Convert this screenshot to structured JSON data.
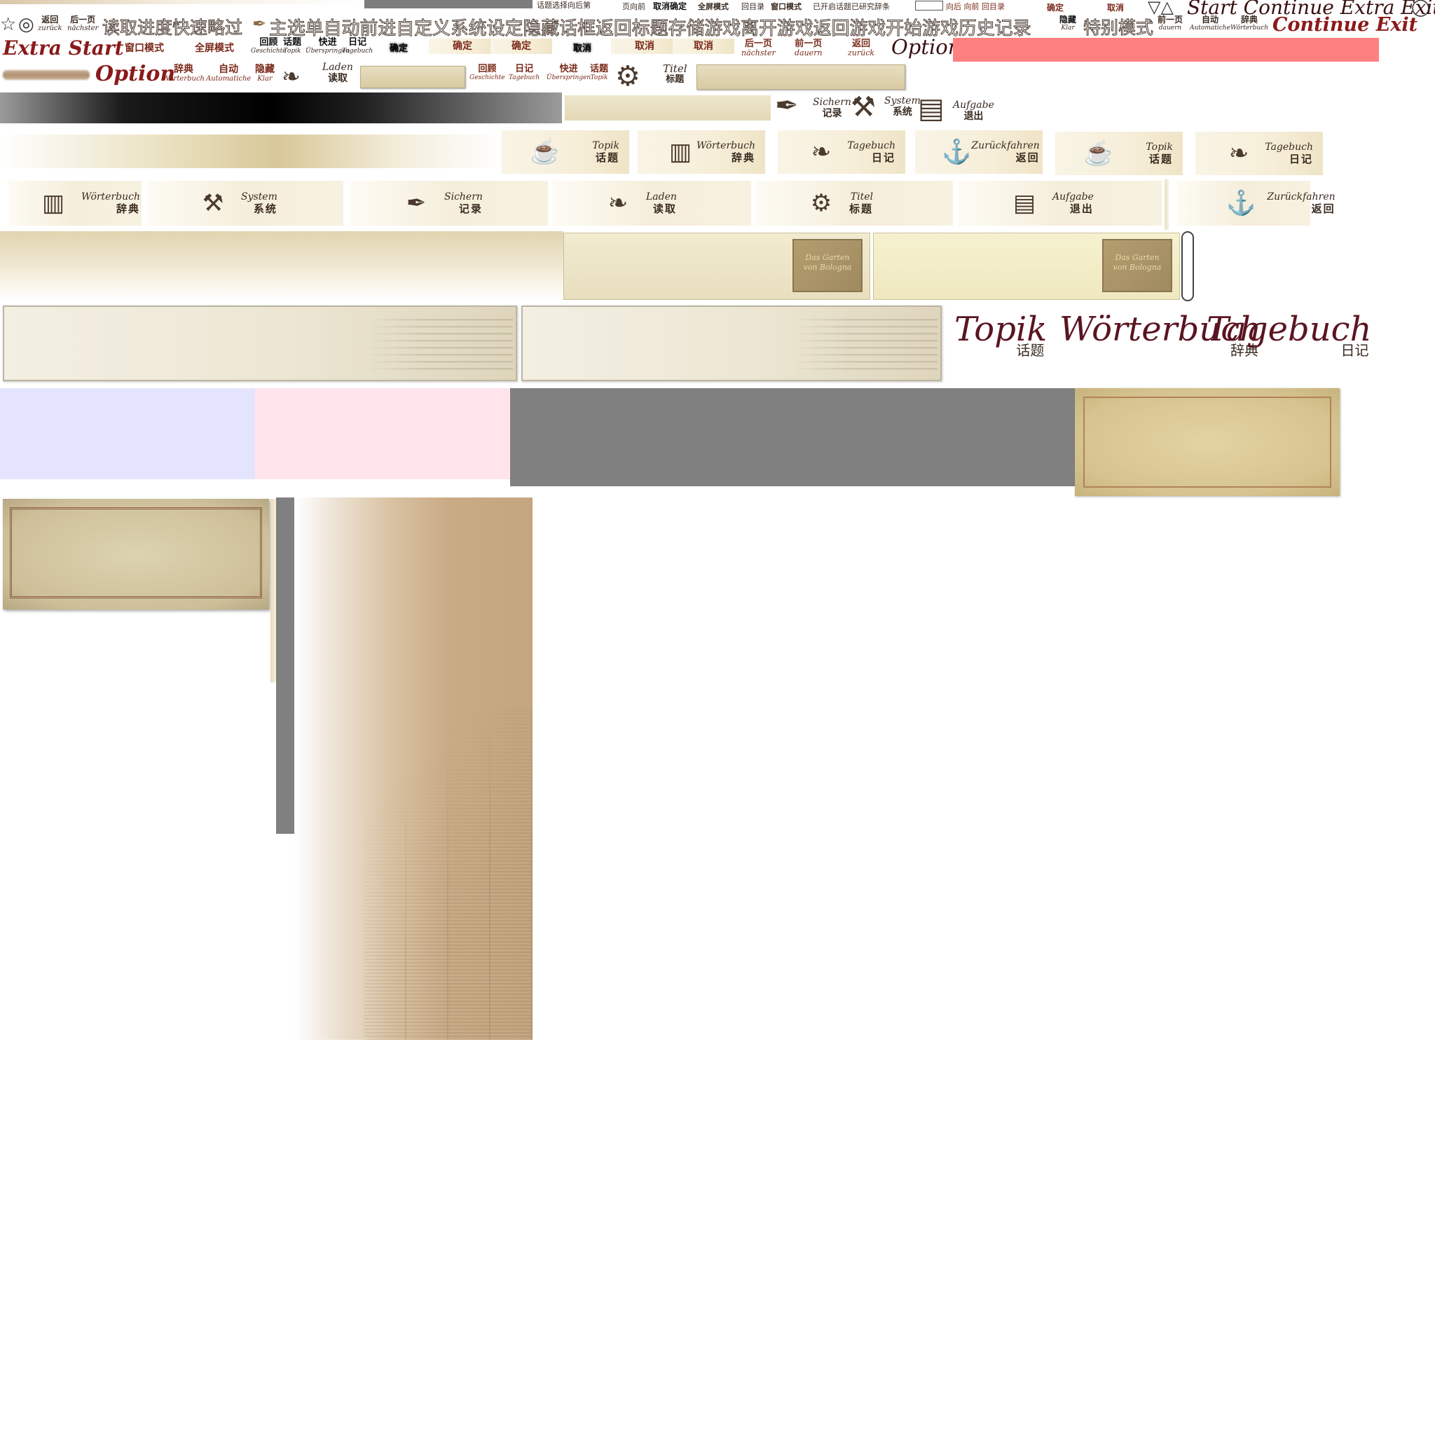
{
  "row_top": {
    "small_labels": [
      "话题选择",
      "向后",
      "第",
      "页",
      "向前",
      "取消",
      "确定",
      "全屏模式",
      "回目录",
      "窗口模式",
      "已开启",
      "话题",
      "已研究",
      "辞条"
    ],
    "nav_labels": [
      "向后",
      "向前",
      "回目录"
    ],
    "confirm": "确定",
    "cancel": "取消",
    "triangles": "▽△",
    "script_menu": "Start Continue Extra Exit",
    "circle": "◯"
  },
  "row2": {
    "star": "☆",
    "circle": "◎",
    "back": {
      "zh": "返回",
      "de": "zurück"
    },
    "next": {
      "zh": "后一页",
      "de": "nächster"
    },
    "outlined_text": "读取进度快速略过",
    "quill": "✒",
    "outlined_text2": "主选单自动前进自定义系统设定隐藏话框返回标题存储游戏离开游戏返回游戏开始游戏历史记录",
    "hide": {
      "zh": "隐藏",
      "de": "Klar"
    },
    "special_mode": "特别模式",
    "prev_page": {
      "zh": "前一页",
      "de": "dauern"
    },
    "auto": {
      "zh": "自动",
      "de": "Automatiche"
    },
    "dict": {
      "zh": "辞典",
      "de": "Wörterbuch"
    },
    "continue_exit": "Continue Exit"
  },
  "row3": {
    "extra_start": "Extra Start",
    "window_mode": "窗口模式",
    "fullscreen_mode": "全屏模式",
    "review": {
      "zh": "回顾",
      "de": "Geschichte"
    },
    "topic": {
      "zh": "话题",
      "de": "Topik"
    },
    "skip": {
      "zh": "快进",
      "de": "Überspringen"
    },
    "diary": {
      "zh": "日记",
      "de": "Tagebuch"
    },
    "confirm_black": "确定",
    "confirm1": "确定",
    "confirm2": "确定",
    "cancel_black": "取消",
    "cancel1": "取消",
    "cancel2": "取消",
    "next_page": {
      "zh": "后一页",
      "de": "nächster"
    },
    "prev_page": {
      "zh": "前一页",
      "de": "dauern"
    },
    "back": {
      "zh": "返回",
      "de": "zurück"
    },
    "option": "Option",
    "red_bar_color": "#ff8080"
  },
  "row4": {
    "option": "Option",
    "dict": {
      "zh": "辞典",
      "de": "Wörterbuch"
    },
    "auto": {
      "zh": "自动",
      "de": "Automatiche"
    },
    "hide": {
      "zh": "隐藏",
      "de": "Klar"
    },
    "load": {
      "de": "Laden",
      "zh": "读取"
    },
    "review": {
      "zh": "回顾",
      "de": "Geschichte"
    },
    "diary": {
      "zh": "日记",
      "de": "Tagebuch"
    },
    "skip": {
      "zh": "快进",
      "de": "Überspringen"
    },
    "topic": {
      "zh": "话题",
      "de": "Topik"
    },
    "title": {
      "de": "Titel",
      "zh": "标题"
    }
  },
  "row5": {
    "save": {
      "de": "Sichern",
      "zh": "记录"
    },
    "system": {
      "de": "System",
      "zh": "系统"
    },
    "exit": {
      "de": "Aufgabe",
      "zh": "退出"
    }
  },
  "row6_tabs": [
    {
      "icon": "teacup-icon",
      "glyph": "☕",
      "de": "Topik",
      "zh": "话题"
    },
    {
      "icon": "books-icon",
      "glyph": "▥",
      "de": "Wörterbuch",
      "zh": "辞典"
    },
    {
      "icon": "open-book-icon",
      "glyph": "❧",
      "de": "Tagebuch",
      "zh": "日记"
    },
    {
      "icon": "anchor-icon",
      "glyph": "⚓",
      "de": "Zurückfahren",
      "zh": "返回"
    },
    {
      "icon": "teacup-icon",
      "glyph": "☕",
      "de": "Topik",
      "zh": "话题"
    },
    {
      "icon": "open-book-icon",
      "glyph": "❧",
      "de": "Tagebuch",
      "zh": "日记"
    }
  ],
  "row7_tabs": [
    {
      "icon": "books-icon",
      "glyph": "▥",
      "de": "Wörterbuch",
      "zh": "辞典"
    },
    {
      "icon": "wrench-icon",
      "glyph": "⚒",
      "de": "System",
      "zh": "系统"
    },
    {
      "icon": "quill-icon",
      "glyph": "✒",
      "de": "Sichern",
      "zh": "记录"
    },
    {
      "icon": "open-book-icon",
      "glyph": "❧",
      "de": "Laden",
      "zh": "读取"
    },
    {
      "icon": "gears-icon",
      "glyph": "⚙",
      "de": "Titel",
      "zh": "标题"
    },
    {
      "icon": "book-stack-icon",
      "glyph": "▤",
      "de": "Aufgabe",
      "zh": "退出"
    },
    {
      "icon": "anchor-icon",
      "glyph": "⚓",
      "de": "Zurückfahren",
      "zh": "返回"
    }
  ],
  "save_slot": {
    "thumb_text_line1": "Das Garten",
    "thumb_text_line2": "von Bologna"
  },
  "big_tabs": [
    {
      "de": "Topik",
      "zh": "话题"
    },
    {
      "de": "Wörterbuch",
      "zh": "辞典"
    },
    {
      "de": "Tagebuch",
      "zh": "日记"
    }
  ],
  "colors": {
    "lavender": "#e4e4ff",
    "pink": "#ffe4ec",
    "gray": "#808080",
    "parchment": "#d8c89a",
    "script_red": "#8a1a1a"
  }
}
